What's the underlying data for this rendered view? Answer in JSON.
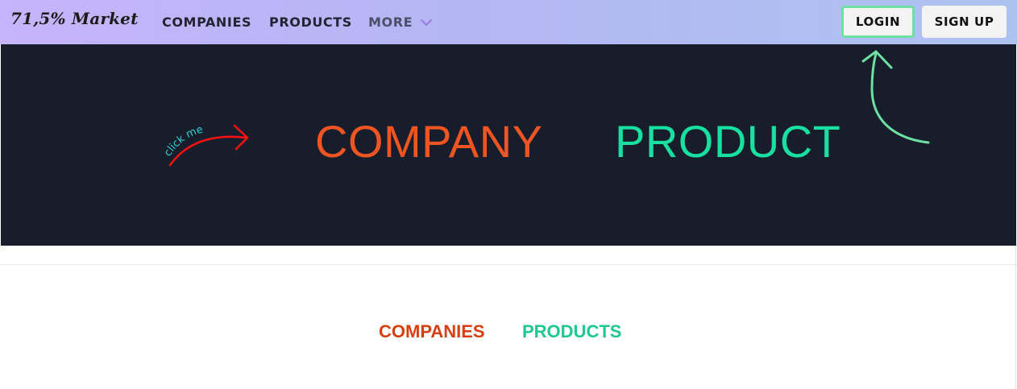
{
  "navbar": {
    "logo": "71,5% Market",
    "links": {
      "companies": "COMPANIES",
      "products": "PRODUCTS",
      "more": "MORE"
    },
    "login_label": "LOGIN",
    "signup_label": "SIGN UP",
    "chevron_icon": "chevron-down-icon",
    "colors": {
      "gradient_start": "#c7b4fb",
      "gradient_end": "#adc3ef",
      "chevron": "#9b7be0"
    }
  },
  "hero": {
    "company_label": "COMPANY",
    "product_label": "PRODUCT",
    "hint_text": "click me",
    "colors": {
      "background": "#181d2b",
      "company": "#ee5522",
      "product": "#17e0a0",
      "hint_text": "#2fd1d1",
      "hint_arrow": "#ff1010",
      "login_arrow": "#6ee0a2"
    }
  },
  "tabs": {
    "companies": "COMPANIES",
    "products": "PRODUCTS",
    "colors": {
      "companies": "#d63f12",
      "products": "#1fc98d"
    }
  }
}
